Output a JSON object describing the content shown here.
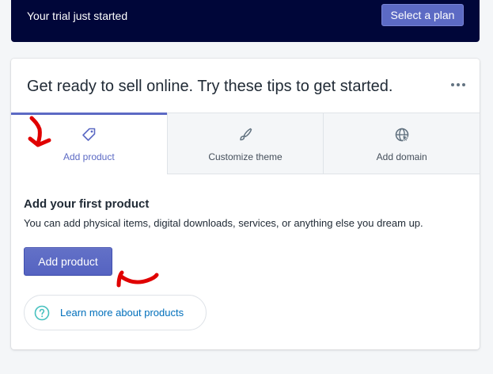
{
  "trial_banner": {
    "text": "Your trial just started",
    "button_label": "Select a plan"
  },
  "card": {
    "title": "Get ready to sell online. Try these tips to get started.",
    "more_icon": "horizontal-dots-icon"
  },
  "tabs": [
    {
      "label": "Add product",
      "icon": "tag-icon",
      "active": true
    },
    {
      "label": "Customize theme",
      "icon": "paintbrush-icon",
      "active": false
    },
    {
      "label": "Add domain",
      "icon": "globe-icon",
      "active": false
    }
  ],
  "content": {
    "title": "Add your first product",
    "description": "You can add physical items, digital downloads, services, or anything else you dream up.",
    "button_label": "Add product",
    "learn_more_label": "Learn more about products",
    "learn_more_icon": "question-circle-icon"
  },
  "colors": {
    "banner_bg": "#000639",
    "accent": "#5c6ac4",
    "link": "#006fbb",
    "annotation": "#e00000"
  }
}
